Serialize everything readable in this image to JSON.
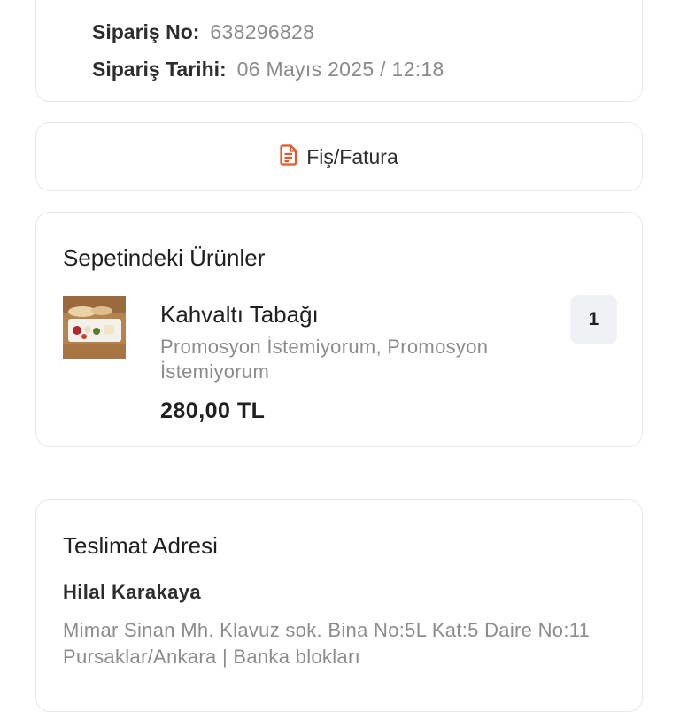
{
  "order": {
    "no_label": "Sipariş No:",
    "no_value": "638296828",
    "date_label": "Sipariş Tarihi:",
    "date_value": "06 Mayıs 2025 / 12:18"
  },
  "receipt": {
    "icon": "document-icon",
    "label": "Fiş/Fatura",
    "accent_color": "#e8562a"
  },
  "basket": {
    "title": "Sepetindeki Ürünler",
    "items": [
      {
        "name": "Kahvaltı Tabağı",
        "options": "Promosyon İstemiyorum, Promosyon İstemiyorum",
        "price": "280,00 TL",
        "quantity": "1"
      }
    ]
  },
  "address": {
    "title": "Teslimat Adresi",
    "recipient": "Hilal Karakaya",
    "text": "Mimar Sinan Mh. Klavuz sok. Bina No:5L Kat:5 Daire No:11 Pursaklar/Ankara | Banka blokları"
  }
}
